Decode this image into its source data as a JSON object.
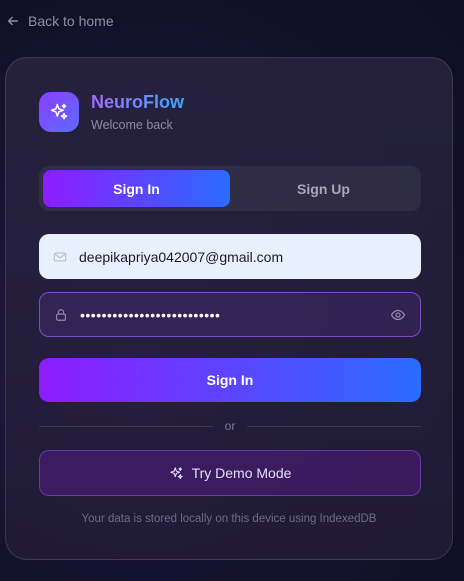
{
  "nav": {
    "back_label": "Back to home"
  },
  "brand": {
    "name": "NeuroFlow",
    "subtitle": "Welcome back"
  },
  "tabs": [
    {
      "label": "Sign In",
      "active": true
    },
    {
      "label": "Sign Up",
      "active": false
    }
  ],
  "form": {
    "email_value": "deepikapriya042007@gmail.com",
    "password_value": "••••••••••••••••••••••••••",
    "submit_label": "Sign In"
  },
  "divider_text": "or",
  "demo": {
    "label": "Try Demo Mode"
  },
  "footnote": "Your data is stored locally on this device using IndexedDB",
  "colors": {
    "accent_start": "#8e1cff",
    "accent_end": "#2a6cff",
    "background": "#161330"
  },
  "icons": {
    "back": "arrow-left-icon",
    "logo": "sparkles-icon",
    "email": "mail-icon",
    "password": "lock-icon",
    "reveal": "eye-icon",
    "demo": "sparkles-icon"
  }
}
